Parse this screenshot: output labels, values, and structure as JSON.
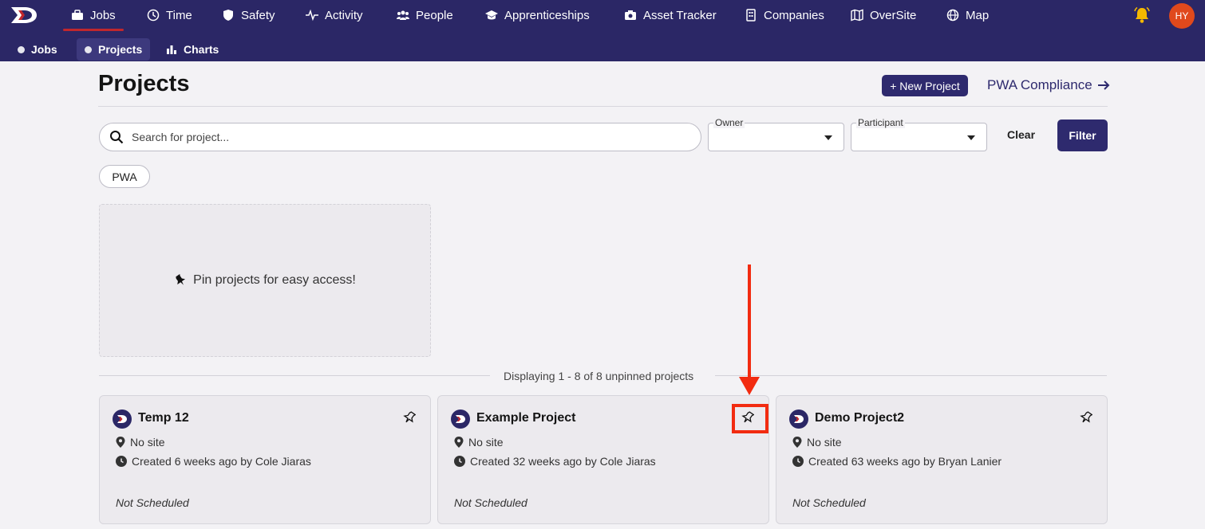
{
  "nav": {
    "items": [
      {
        "label": "Jobs",
        "icon": "briefcase-icon"
      },
      {
        "label": "Time",
        "icon": "clock-icon"
      },
      {
        "label": "Safety",
        "icon": "shield-icon"
      },
      {
        "label": "Activity",
        "icon": "pulse-icon"
      },
      {
        "label": "People",
        "icon": "people-icon"
      },
      {
        "label": "Apprenticeships",
        "icon": "graduation-cap-icon"
      },
      {
        "label": "Asset Tracker",
        "icon": "camera-icon"
      },
      {
        "label": "Companies",
        "icon": "building-icon"
      },
      {
        "label": "OverSite",
        "icon": "map-icon"
      },
      {
        "label": "Map",
        "icon": "globe-icon"
      }
    ],
    "avatar": "HY"
  },
  "subnav": {
    "items": [
      {
        "label": "Jobs"
      },
      {
        "label": "Projects"
      },
      {
        "label": "Charts"
      }
    ]
  },
  "header": {
    "title": "Projects",
    "new_project": "+ New Project",
    "pwa_compliance": "PWA Compliance"
  },
  "filters": {
    "search_placeholder": "Search for project...",
    "owner_label": "Owner",
    "participant_label": "Participant",
    "clear": "Clear",
    "filter": "Filter",
    "chip": "PWA"
  },
  "pinned": {
    "empty_text": "Pin projects for easy access!"
  },
  "list": {
    "displaying": "Displaying 1 - 8 of 8 unpinned projects",
    "cards": [
      {
        "name": "Temp 12",
        "site": "No site",
        "created": "Created 6 weeks ago by Cole Jiaras",
        "schedule": "Not Scheduled"
      },
      {
        "name": "Example Project",
        "site": "No site",
        "created": "Created 32 weeks ago by Cole Jiaras",
        "schedule": "Not Scheduled"
      },
      {
        "name": "Demo Project2",
        "site": "No site",
        "created": "Created 63 weeks ago by Bryan Lanier",
        "schedule": "Not Scheduled"
      }
    ]
  },
  "colors": {
    "nav_bg": "#2b2766",
    "accent": "#2e2a6e",
    "brand_red": "#c1272d",
    "annotation_red": "#f22b10"
  }
}
